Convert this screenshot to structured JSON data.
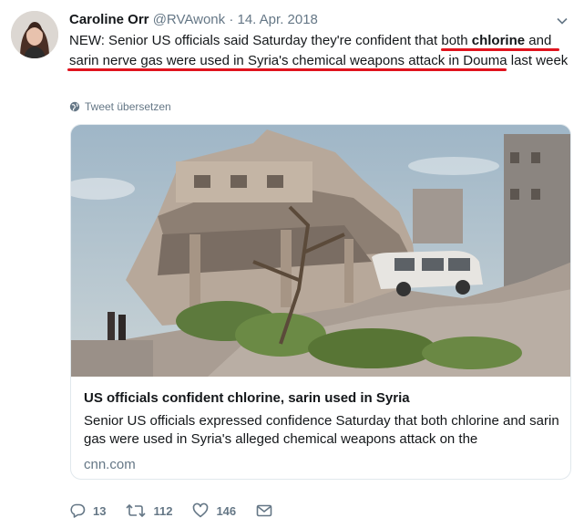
{
  "tweet": {
    "author_name": "Caroline Orr",
    "handle": "@RVAwonk",
    "separator": "·",
    "date": "14. Apr. 2018",
    "text": {
      "part1": "NEW: Senior US officials said Saturday they're confident that ",
      "both": "both",
      "space1": " ",
      "chlorine": "chlorine",
      "and": " and",
      "line2": "sarin nerve gas were used in Syria's chemical weapons attack in Douma",
      "tail": " last week"
    },
    "translate_label": "Tweet übersetzen"
  },
  "card": {
    "title": "US officials confident chlorine, sarin used in Syria",
    "description": "Senior US officials expressed confidence Saturday that both chlorine and sarin gas were used in Syria's alleged chemical weapons attack on the",
    "domain": "cnn.com"
  },
  "actions": {
    "reply_count": "13",
    "retweet_count": "112",
    "like_count": "146"
  },
  "colors": {
    "underline": "#e0141e",
    "muted": "#657786"
  },
  "icons": [
    "chevron-down-icon",
    "globe-icon",
    "reply-icon",
    "retweet-icon",
    "like-icon",
    "message-icon"
  ]
}
